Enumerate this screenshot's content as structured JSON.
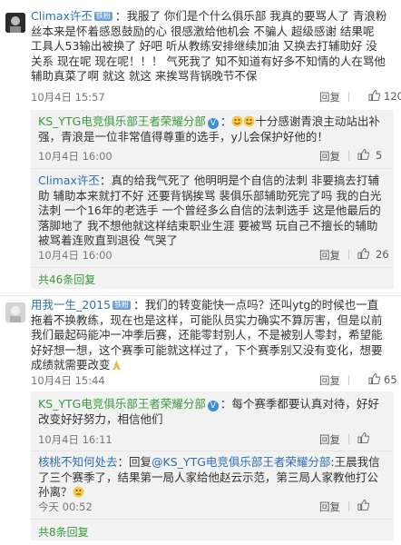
{
  "comments": [
    {
      "user": "Climax许丕",
      "badge": "铁粉",
      "text": "我服了 你们是个什么俱乐部 我真的要骂人了 青浪粉丝本来是怀着感恩鼓励的心  很感激给他机会 不骗人 超级感谢 结果呢 工具人53输出被换了 好吧 听从教练安排继续加油 又换去打辅助好 没关系 现在呢 现在呢！！！ 气死我了 知不知道有好多不知情的人在骂他辅助真菜了啊  就这 就这 来挨骂背锅晚节不保",
      "time": "10月4日 15:57",
      "reply_label": "回复",
      "likes": "120",
      "replies": [
        {
          "user": "KS_YTG电竞俱乐部王者荣耀分部",
          "text": "十分感谢青浪主动站出补强，青浪是一位非常值得尊重的选手，y儿会保护好他的！",
          "time": "10月4日 16:00",
          "reply_label": "回复",
          "likes": "5"
        },
        {
          "user": "Climax许丕",
          "text": "真的给我气死了 他明明是个自信的法刺 非要搞去打辅助 辅助本来就打不好 还要背锅挨骂 裴俱乐部辅助死完了吗  我的白光法刺 一个16年的老选手 一个曾经多么自信的法刺选手 这是他最后的落脚地了 我不想他就这样结束职业生涯 要被骂 玩自己不擅长的辅助被骂着连败直到退役 气哭了",
          "time": "10月4日 16:00",
          "reply_label": "回复",
          "likes": "26"
        }
      ],
      "more_replies": "共46条回复"
    },
    {
      "user": "用我一生_2015",
      "badge": "铁粉",
      "text": "我们的转变能快一点吗？还叫ytg的时候也一直拖着不换教练，现在也是这样，可能队员实力确实不算厉害，但是以前我们最起码能冲一冲季后赛，还能零封别人，不是被别人零封，希望能好好想一想，这个赛季可能就这样过了，下个赛季别又没有变化，想要成绩就需要改变",
      "time": "10月4日 15:44",
      "reply_label": "回复",
      "likes": "65",
      "replies": [
        {
          "user": "KS_YTG电竞俱乐部王者荣耀分部",
          "text": "每个赛季都要认真对待，好好改变好好努力，相信他们",
          "time": "10月4日 16:11",
          "reply_label": "回复",
          "likes": ""
        },
        {
          "user": "核桃不知何处去",
          "mention": "@KS_YTG电竞俱乐部王者荣耀分部",
          "text": "王晨我信了三个赛季了，结果第一局人家给他赵云示范，第三局人家教他打公孙离？",
          "time": "今天 00:52",
          "reply_label": "回复",
          "likes": ""
        }
      ],
      "more_replies": "共8条回复"
    }
  ],
  "colors": {
    "link": "#2d6fb3",
    "green": "#3a9a3a",
    "box": "#f2f2f2"
  },
  "icons": [
    "avatar-image",
    "thumb-up-icon",
    "v-verified-icon",
    "emoji-icon"
  ]
}
